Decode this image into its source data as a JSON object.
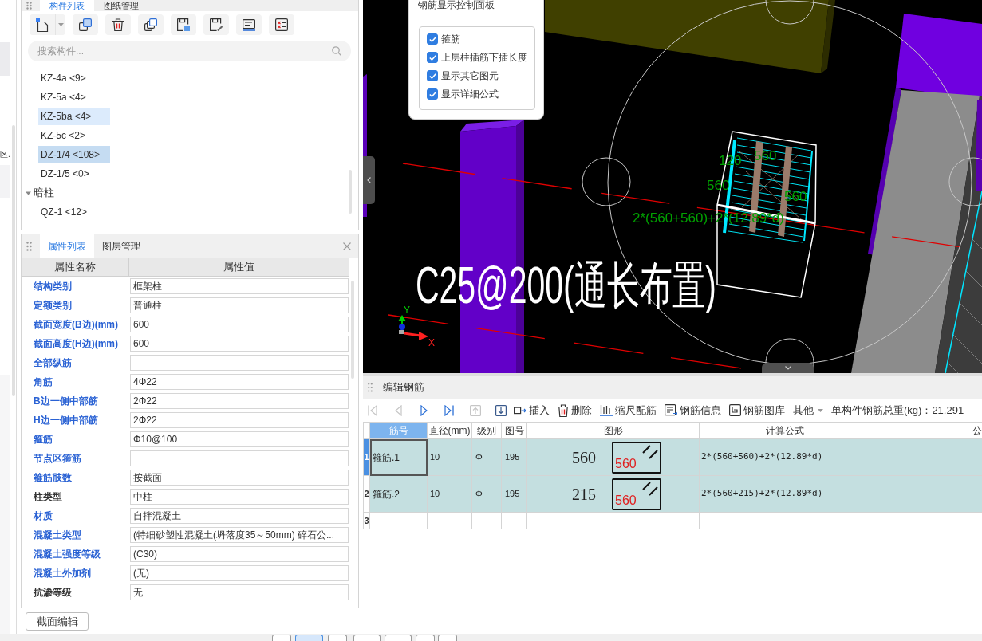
{
  "left_panel": {
    "text": "区."
  },
  "component_panel": {
    "tabs": [
      {
        "label": "构件列表",
        "selected": true
      },
      {
        "label": "图纸管理",
        "selected": false
      }
    ],
    "search": {
      "placeholder": "搜索构件..."
    },
    "tree": [
      {
        "kind": "item",
        "label": "KZ-4a <9>",
        "selected": false,
        "hovered": false
      },
      {
        "kind": "item",
        "label": "KZ-5a <4>",
        "selected": false,
        "hovered": false
      },
      {
        "kind": "item",
        "label": "KZ-5ba <4>",
        "selected": false,
        "hovered": true
      },
      {
        "kind": "item",
        "label": "KZ-5c <2>",
        "selected": false,
        "hovered": false
      },
      {
        "kind": "item",
        "label": "DZ-1/4 <108>",
        "selected": true,
        "hovered": false
      },
      {
        "kind": "item",
        "label": "DZ-1/5 <0>",
        "selected": false,
        "hovered": false
      },
      {
        "kind": "group",
        "label": "暗柱",
        "expanded": true,
        "children": [
          {
            "kind": "item",
            "label": "QZ-1 <12>",
            "selected": false,
            "hovered": false
          }
        ]
      }
    ]
  },
  "property_panel": {
    "tabs": [
      {
        "label": "属性列表",
        "selected": true
      },
      {
        "label": "图层管理",
        "selected": false
      }
    ],
    "columns": [
      "属性名称",
      "属性值"
    ],
    "rows": [
      {
        "name": "结构类别",
        "value": "框架柱",
        "color": "#2a62d4"
      },
      {
        "name": "定额类别",
        "value": "普通柱",
        "color": "#2a62d4"
      },
      {
        "name": "截面宽度(B边)(mm)",
        "value": "600",
        "color": "#2a62d4"
      },
      {
        "name": "截面高度(H边)(mm)",
        "value": "600",
        "color": "#2a62d4"
      },
      {
        "name": "全部纵筋",
        "color": "#2a62d4"
      },
      {
        "name": "角筋",
        "value": "4Φ22",
        "color": "#2a62d4"
      },
      {
        "name": "B边一侧中部筋",
        "value": "2Φ22",
        "color": "#2a62d4"
      },
      {
        "name": "H边一侧中部筋",
        "value": "2Φ22",
        "color": "#2a62d4"
      },
      {
        "name": "箍筋",
        "value": "Φ10@100",
        "color": "#2a62d4"
      },
      {
        "name": "节点区箍筋",
        "color": "#2a62d4"
      },
      {
        "name": "箍筋肢数",
        "value": "按截面",
        "color": "#2a62d4"
      },
      {
        "name": "柱类型",
        "value": "中柱",
        "color": "#333333"
      },
      {
        "name": "材质",
        "value": "自拌混凝土",
        "color": "#2a62d4"
      },
      {
        "name": "混凝土类型",
        "value": "(特细砂塑性混凝土(坍落度35～50mm) 碎石公...",
        "color": "#2a62d4"
      },
      {
        "name": "混凝土强度等级",
        "value": "(C30)",
        "color": "#2a62d4"
      },
      {
        "name": "混凝土外加剂",
        "value": "(无)",
        "color": "#2a62d4"
      },
      {
        "name": "抗渗等级",
        "value": "无",
        "color": "#333333"
      }
    ],
    "button": "截面编辑"
  },
  "viewport": {
    "control_panel": {
      "title": "钢筋显示控制面板",
      "options": [
        {
          "label": "箍筋",
          "checked": true
        },
        {
          "label": "上层柱插筋下插长度",
          "checked": true
        },
        {
          "label": "显示其它图元",
          "checked": true
        },
        {
          "label": "显示详细公式",
          "checked": true
        }
      ]
    },
    "annotation": "C25@200(通长布置)",
    "dimension_labels": [
      {
        "kind": "hook",
        "text": "120"
      },
      {
        "kind": "top",
        "text": "560"
      },
      {
        "kind": "left",
        "text": "560"
      },
      {
        "kind": "right",
        "text": "560"
      },
      {
        "kind": "formula",
        "text": "2*(560+560)+2*(12.89*d)"
      }
    ],
    "axes": {
      "x": "X",
      "y": "Y"
    }
  },
  "rebar_editor": {
    "title": "编辑钢筋",
    "navigation": [
      {
        "kind": "first",
        "disabled": true
      },
      {
        "kind": "previous",
        "disabled": true
      },
      {
        "kind": "next",
        "disabled": false
      },
      {
        "kind": "last",
        "disabled": false
      },
      {
        "kind": "move_up",
        "disabled": true
      },
      {
        "kind": "move_down",
        "disabled": false
      }
    ],
    "actions": [
      {
        "kind": "insert",
        "label": "插入"
      },
      {
        "kind": "delete",
        "label": "删除"
      },
      {
        "kind": "scale",
        "label": "缩尺配筋"
      },
      {
        "kind": "info",
        "label": "钢筋信息"
      },
      {
        "kind": "library",
        "label": "钢筋图库"
      },
      {
        "kind": "menu",
        "label": "其他"
      }
    ],
    "total_weight": "单构件钢筋总重(kg)：21.291",
    "table": {
      "columns": [
        {
          "label": "筋号",
          "selected": true
        },
        {
          "label": "直径(mm)",
          "selected": false
        },
        {
          "label": "级别",
          "selected": false
        },
        {
          "label": "图号",
          "selected": false
        },
        {
          "label": "图形",
          "selected": false
        },
        {
          "label": "计算公式",
          "selected": false
        },
        {
          "label": "公",
          "selected": false
        }
      ],
      "rows": [
        {
          "number": "1",
          "selected": true,
          "bar_no": "箍筋.1",
          "diameter": "10",
          "grade": "Φ",
          "shape_no": "195",
          "shape_length": "560",
          "shape_label": "560",
          "formula": "2*(560+560)+2*(12.89*d)"
        },
        {
          "number": "2",
          "selected": false,
          "bar_no": "箍筋.2",
          "diameter": "10",
          "grade": "Φ",
          "shape_no": "195",
          "shape_length": "215",
          "shape_label": "560",
          "formula": "2*(560+215)+2*(12.89*d)"
        },
        {
          "number": "3",
          "selected": false
        }
      ]
    }
  },
  "bottom_toolbar": {
    "buttons": [
      {
        "selected": false
      },
      {
        "selected": true
      },
      {
        "selected": false
      },
      {
        "selected": false
      },
      {
        "selected": false
      },
      {
        "selected": false
      },
      {
        "selected": false
      }
    ]
  }
}
